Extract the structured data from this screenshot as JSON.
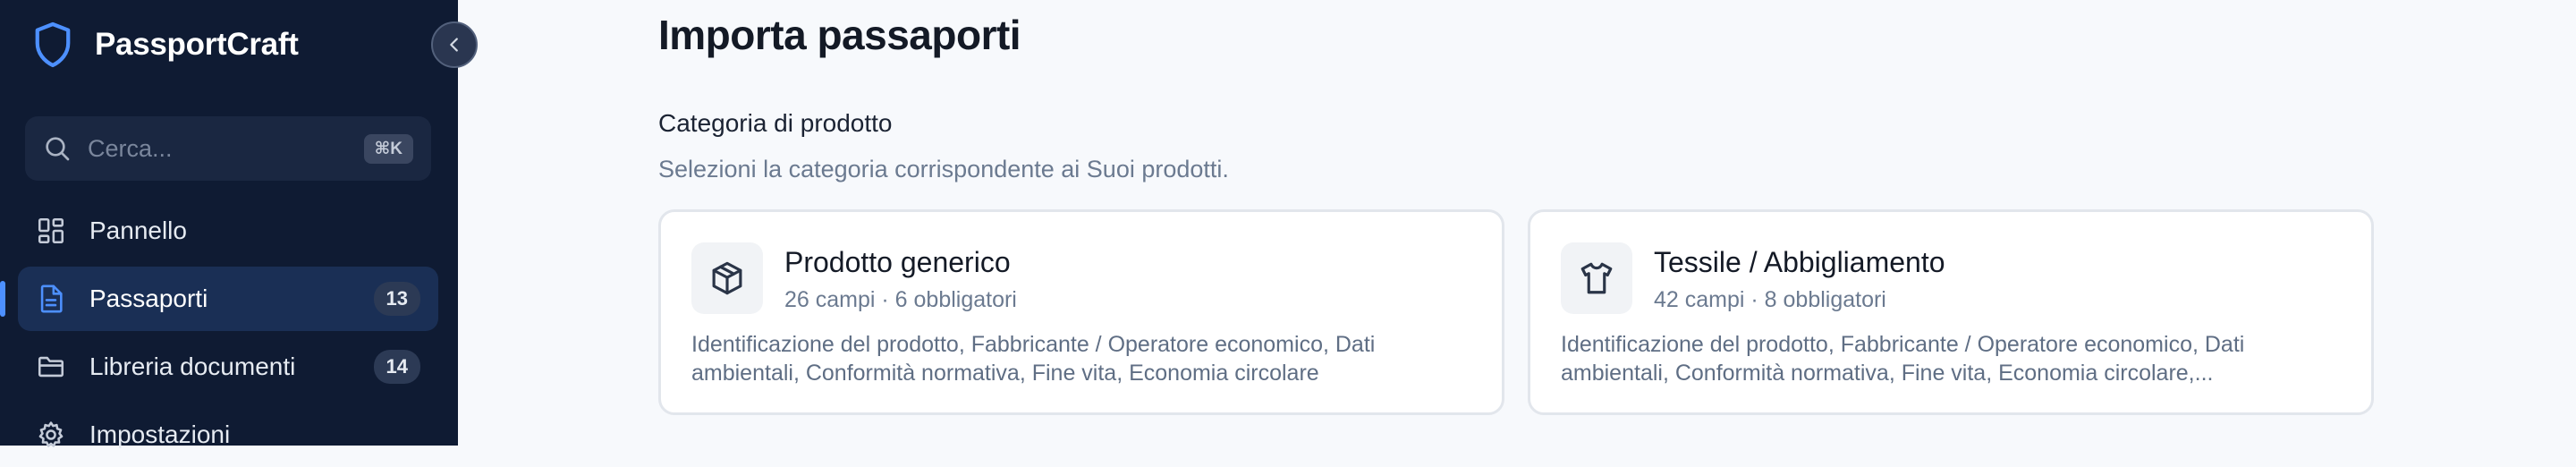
{
  "brand": {
    "name": "PassportCraft"
  },
  "search": {
    "placeholder": "Cerca...",
    "shortcut": "⌘K"
  },
  "nav": {
    "items": [
      {
        "label": "Pannello",
        "count": null,
        "icon": "dashboard-icon"
      },
      {
        "label": "Passaporti",
        "count": "13",
        "icon": "document-icon",
        "active": true
      },
      {
        "label": "Libreria documenti",
        "count": "14",
        "icon": "folder-icon"
      },
      {
        "label": "Impostazioni",
        "count": null,
        "icon": "gear-icon"
      }
    ]
  },
  "main": {
    "title": "Importa passaporti",
    "section": {
      "title": "Categoria di prodotto",
      "subtitle": "Selezioni la categoria corrispondente ai Suoi prodotti."
    },
    "cards": [
      {
        "icon": "package-icon",
        "title": "Prodotto generico",
        "meta": "26 campi · 6 obbligatori",
        "desc": "Identificazione del prodotto, Fabbricante / Operatore economico, Dati ambientali, Conformità normativa, Fine vita, Economia circolare"
      },
      {
        "icon": "shirt-icon",
        "title": "Tessile / Abbigliamento",
        "meta": "42 campi · 8 obbligatori",
        "desc": "Identificazione del prodotto, Fabbricante / Operatore economico, Dati ambientali, Conformità normativa, Fine vita, Economia circolare,..."
      }
    ]
  },
  "colors": {
    "sidebar_bg": "#0f1b33",
    "accent": "#4d90ff",
    "active_item_bg": "#1a2f55",
    "page_bg": "#f7f9fc"
  }
}
